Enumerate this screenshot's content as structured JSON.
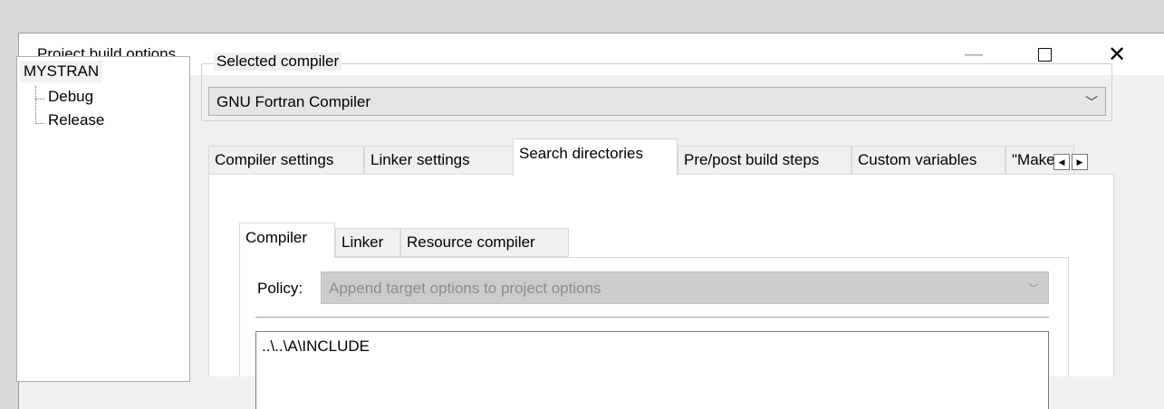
{
  "window": {
    "title": "Project build options",
    "minimize_glyph": "—",
    "close_glyph": "✕"
  },
  "tree": {
    "root": "MYSTRAN",
    "children": [
      "Debug",
      "Release"
    ]
  },
  "compiler_group": {
    "label": "Selected compiler",
    "selected": "GNU Fortran Compiler",
    "arrow": "﹀"
  },
  "tabs": [
    {
      "label": "Compiler settings",
      "active": false
    },
    {
      "label": "Linker settings",
      "active": false
    },
    {
      "label": "Search directories",
      "active": true
    },
    {
      "label": "Pre/post build steps",
      "active": false
    },
    {
      "label": "Custom variables",
      "active": false
    },
    {
      "label": "\"Make\"",
      "active": false
    }
  ],
  "tab_scroll": {
    "left": "◀",
    "right": "▶"
  },
  "subtabs": [
    {
      "label": "Compiler",
      "active": true
    },
    {
      "label": "Linker",
      "active": false
    },
    {
      "label": "Resource compiler",
      "active": false
    }
  ],
  "policy": {
    "label": "Policy:",
    "value": "Append target options to project options",
    "arrow": "﹀"
  },
  "directories": [
    "..\\..\\A\\INCLUDE"
  ],
  "colors": {
    "window_bg": "#f0f0f0",
    "titlebar_bg": "#ffffff",
    "disabled_text": "#8c8c8c"
  }
}
